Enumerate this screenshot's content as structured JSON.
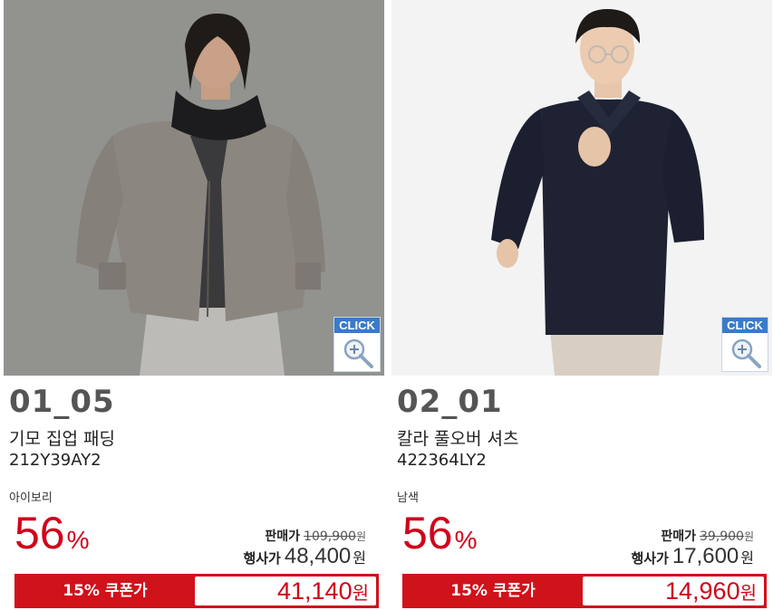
{
  "products": [
    {
      "code": "01_05",
      "name": "기모 집업 패딩",
      "product_code": "212Y39AY2",
      "color": "아이보리",
      "discount": "56",
      "discount_unit": "%",
      "orig_label": "판매가",
      "orig_price": "109,900",
      "orig_unit": "원",
      "sale_label": "행사가",
      "sale_price": "48,400",
      "sale_unit": "원",
      "coupon_label": "15% 쿠폰가",
      "coupon_price": "41,140",
      "coupon_unit": "원",
      "click_label": "CLICK"
    },
    {
      "code": "02_01",
      "name": "칼라 풀오버 셔츠",
      "product_code": "422364LY2",
      "color": "남색",
      "discount": "56",
      "discount_unit": "%",
      "orig_label": "판매가",
      "orig_price": "39,900",
      "orig_unit": "원",
      "sale_label": "행사가",
      "sale_price": "17,600",
      "sale_unit": "원",
      "coupon_label": "15% 쿠폰가",
      "coupon_price": "14,960",
      "coupon_unit": "원",
      "click_label": "CLICK"
    }
  ],
  "colors": {
    "accent_red": "#d0121b",
    "click_blue": "#3a7bc8"
  }
}
